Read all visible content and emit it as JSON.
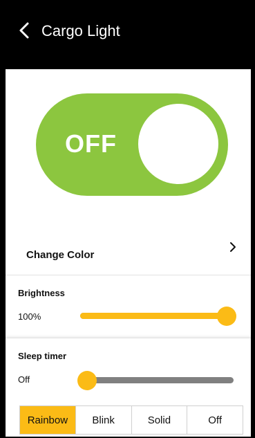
{
  "header": {
    "title": "Cargo Light",
    "back_icon": "chevron-left-icon"
  },
  "power": {
    "label": "OFF",
    "state": "off",
    "color": "#8cc63f"
  },
  "color_row": {
    "label": "Change Color",
    "chevron_icon": "chevron-right-icon"
  },
  "brightness": {
    "title": "Brightness",
    "value_label": "100%",
    "level": 1.0
  },
  "sleep_timer": {
    "title": "Sleep timer",
    "value_label": "Off",
    "level": 0.0
  },
  "modes": {
    "items": [
      "Rainbow",
      "Blink",
      "Solid",
      "Off"
    ],
    "selected": "Rainbow"
  },
  "colors": {
    "accent": "#fbbb16",
    "track": "#808080",
    "header": "#000000"
  }
}
